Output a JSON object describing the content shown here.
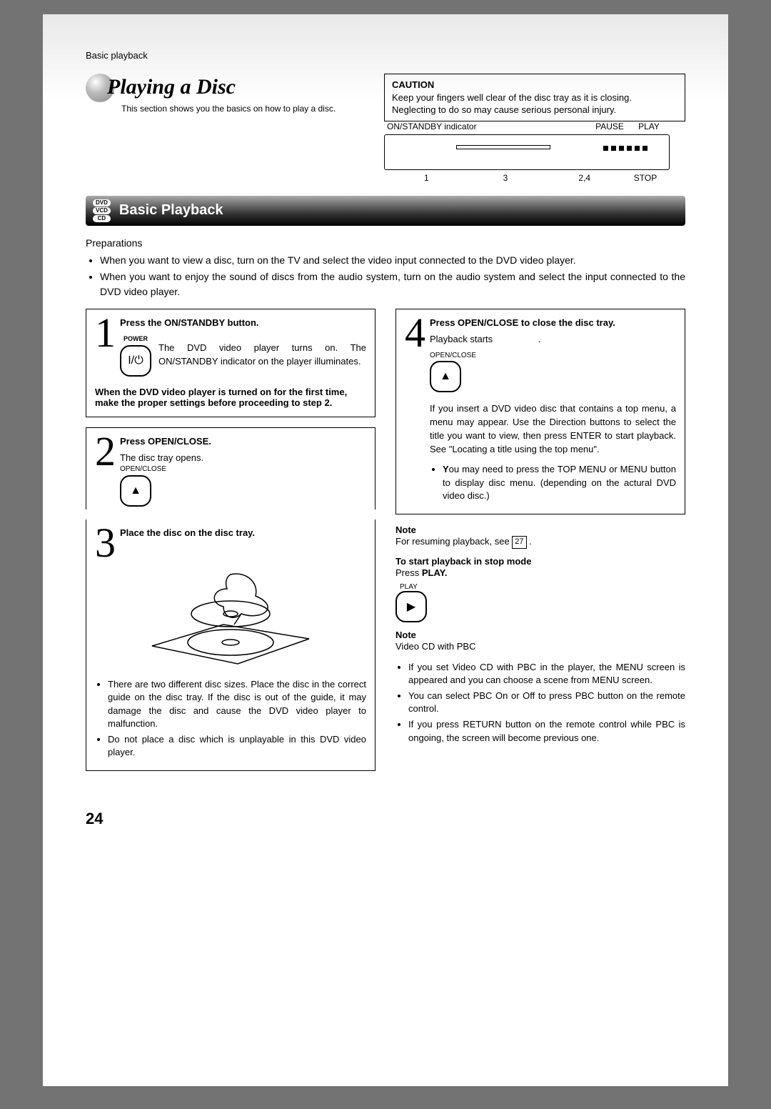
{
  "header": {
    "section": "Basic playback"
  },
  "title": "Playing a Disc",
  "subtitle": "This section shows you the basics on how to play a disc.",
  "caution": {
    "label": "CAUTION",
    "text": "Keep your fingers well clear of the disc tray as it is closing. Neglecting to do so may cause serious personal injury."
  },
  "device": {
    "top": {
      "indicator": "ON/STANDBY indicator",
      "pause": "PAUSE",
      "play": "PLAY"
    },
    "bottom": {
      "n1": "1",
      "n3": "3",
      "n24": "2,4",
      "stop": "STOP"
    }
  },
  "sectionBar": {
    "types": [
      "DVD",
      "VCD",
      "CD"
    ],
    "title": "Basic Playback"
  },
  "preparations": {
    "label": "Preparations",
    "items": [
      "When you want to view a disc, turn on the TV and select the video input connected to the DVD video player.",
      "When you want to enjoy the sound of discs from the audio system, turn on the audio system and select the input connected to the DVD video player."
    ]
  },
  "step1": {
    "num": "1",
    "heading": "Press the ON/STANDBY button.",
    "powerLabel": "POWER",
    "desc": "The DVD video player turns on. The ON/STANDBY indicator on the player illuminates.",
    "note": "When the DVD video player is turned on for the first time, make the proper settings before proceeding to step 2."
  },
  "step2": {
    "num": "2",
    "heading": "Press OPEN/CLOSE.",
    "desc": "The disc tray opens.",
    "iconLabel": "OPEN/CLOSE"
  },
  "step3": {
    "num": "3",
    "heading": "Place the disc on the disc tray.",
    "bullets": [
      "There are two different disc sizes. Place the disc in the correct guide on the disc tray. If the disc is out of the guide, it may damage the disc and cause the DVD video player to malfunction.",
      "Do not place a disc which is unplayable in this DVD video player."
    ]
  },
  "step4": {
    "num": "4",
    "heading": "Press OPEN/CLOSE to close the disc tray.",
    "desc": "Playback starts",
    "iconLabel": "OPEN/CLOSE",
    "after": ".",
    "body": "If you insert a DVD video disc that contains a top menu, a menu may appear. Use the Direction buttons to select the title you want to view, then press ENTER to start playback. See \"Locating a title using the top menu\".",
    "bullets": [
      "You may need to press the TOP MENU or MENU button to display disc menu. (depending on the actural DVD video disc.)"
    ]
  },
  "noteResume": {
    "label": "Note",
    "text": "For resuming playback, see ",
    "ref": "27"
  },
  "stopMode": {
    "heading": "To start playback in stop mode",
    "sub": "Press ",
    "play": "PLAY.",
    "iconLabel": "PLAY"
  },
  "notePBC": {
    "label": "Note",
    "heading": "Video CD with PBC",
    "bullets": [
      "If you set Video CD with PBC in the player, the MENU screen is appeared and you can choose a scene from MENU screen.",
      "You can select PBC On or Off to press PBC button on the remote control.",
      "If you press RETURN button on the remote control while PBC is ongoing, the screen will become previous one."
    ]
  },
  "pageNumber": "24"
}
